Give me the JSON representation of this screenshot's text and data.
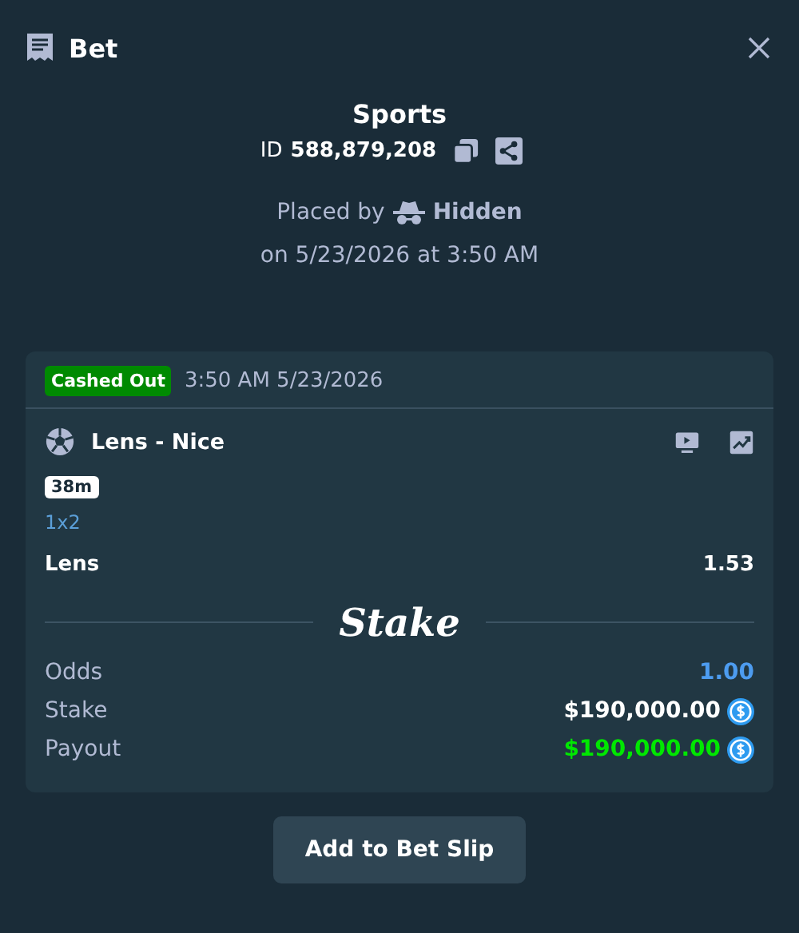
{
  "header": {
    "title": "Bet"
  },
  "bet": {
    "category": "Sports",
    "id_label": "ID",
    "id": "588,879,208",
    "placed_by_label": "Placed by",
    "user": "Hidden",
    "placed_on": "on 5/23/2026 at 3:50 AM"
  },
  "card": {
    "status": "Cashed Out",
    "time": "3:50 AM 5/23/2026",
    "event": "Lens - Nice",
    "live_time": "38m",
    "market": "1x2",
    "selection": "Lens",
    "selection_odds": "1.53",
    "brand": "Stake",
    "summary": [
      {
        "kind": "odds",
        "label": "Odds",
        "value": "1.00"
      },
      {
        "kind": "amount",
        "label": "Stake",
        "value": "$190,000.00"
      },
      {
        "kind": "payout",
        "label": "Payout",
        "value": "$190,000.00"
      }
    ]
  },
  "button": "Add to Bet Slip"
}
